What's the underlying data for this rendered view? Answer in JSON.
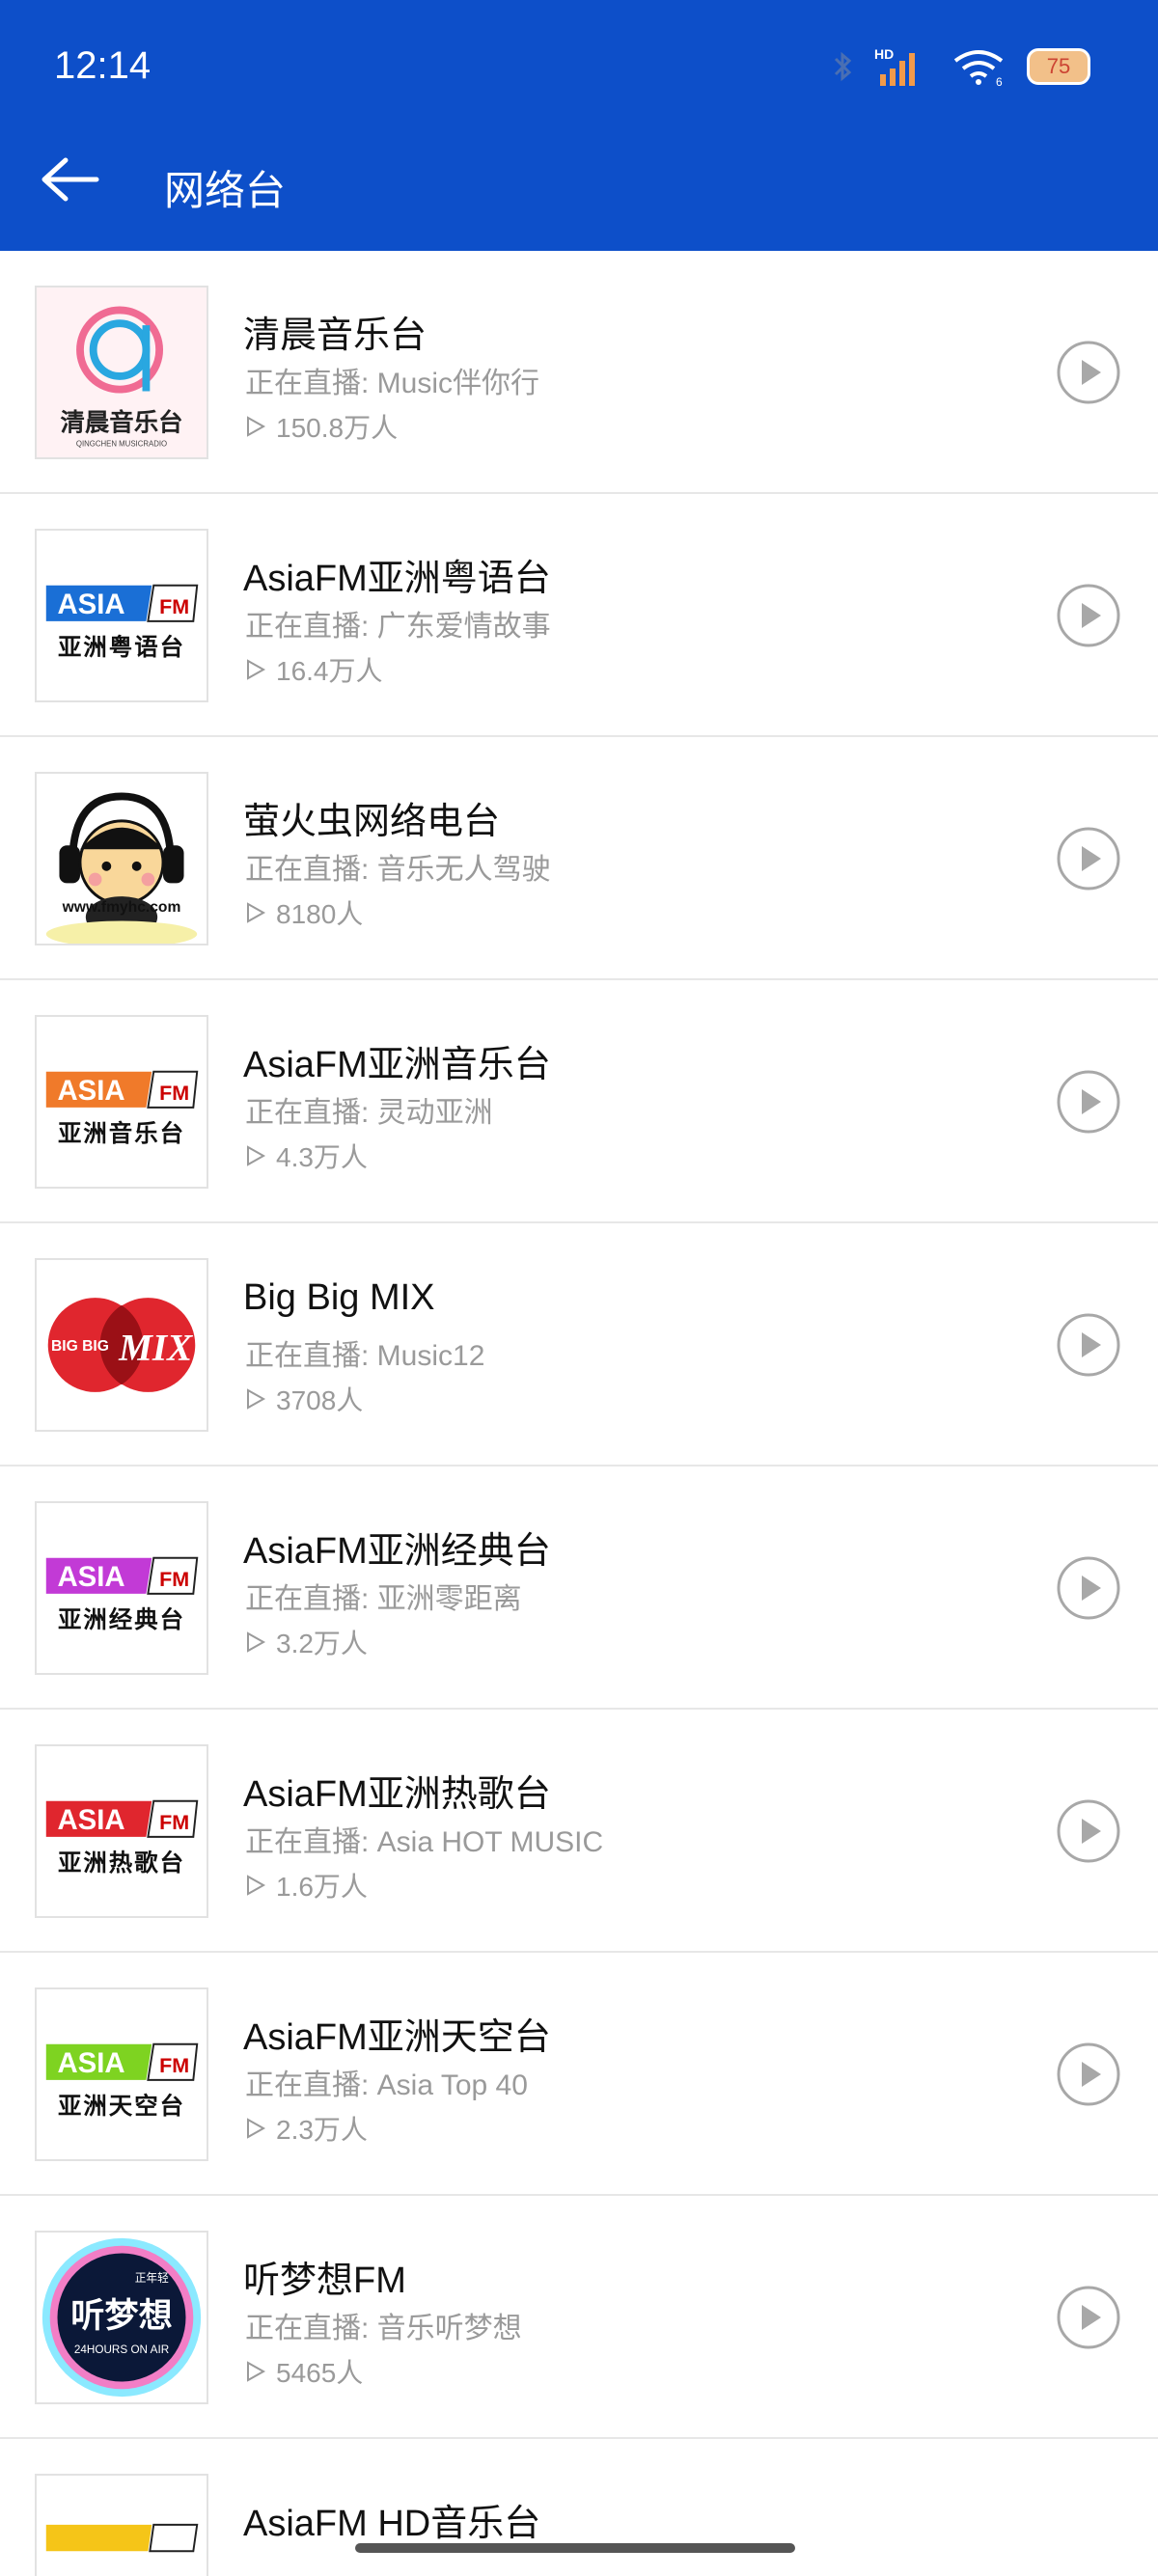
{
  "status_bar": {
    "time": "12:14",
    "network_label": "HD",
    "wifi_sub": "6",
    "battery": "75"
  },
  "header": {
    "title": "网络台"
  },
  "stations": [
    {
      "name": "清晨音乐台",
      "live": "正在直播: Music伴你行",
      "listeners": "150.8万人",
      "logo": "qingchen",
      "logo_text": "清晨音乐台",
      "logo_sub": "QINGCHEN MUSICRADIO"
    },
    {
      "name": "AsiaFM亚洲粤语台",
      "live": "正在直播: 广东爱情故事",
      "listeners": "16.4万人",
      "logo": "asia",
      "logo_text": "亚洲粤语台",
      "accent": "#1a6fd6"
    },
    {
      "name": "萤火虫网络电台",
      "live": "正在直播: 音乐无人驾驶",
      "listeners": "8180人",
      "logo": "firefly",
      "logo_text": "www.fmyhc.com"
    },
    {
      "name": "AsiaFM亚洲音乐台",
      "live": "正在直播: 灵动亚洲",
      "listeners": "4.3万人",
      "logo": "asia",
      "logo_text": "亚洲音乐台",
      "accent": "#f07a2a"
    },
    {
      "name": "Big Big MIX",
      "live": "正在直播: Music12",
      "listeners": "3708人",
      "logo": "bigmix",
      "logo_text": "BIG BIG",
      "logo_sub": "MIX"
    },
    {
      "name": "AsiaFM亚洲经典台",
      "live": "正在直播: 亚洲零距离",
      "listeners": "3.2万人",
      "logo": "asia",
      "logo_text": "亚洲经典台",
      "accent": "#c23ad6"
    },
    {
      "name": "AsiaFM亚洲热歌台",
      "live": "正在直播: Asia HOT MUSIC",
      "listeners": "1.6万人",
      "logo": "asia",
      "logo_text": "亚洲热歌台",
      "accent": "#e0262e"
    },
    {
      "name": "AsiaFM亚洲天空台",
      "live": "正在直播: Asia Top 40",
      "listeners": "2.3万人",
      "logo": "asia",
      "logo_text": "亚洲天空台",
      "accent": "#7ed321"
    },
    {
      "name": "听梦想FM",
      "live": "正在直播: 音乐听梦想",
      "listeners": "5465人",
      "logo": "dream",
      "logo_text": "听梦想",
      "logo_sub": "24HOURS ON AIR",
      "logo_tag": "正年轻"
    },
    {
      "name": "AsiaFM HD音乐台",
      "live": "",
      "listeners": "",
      "logo": "partial",
      "accent": "#f5c518"
    }
  ],
  "asia_badge": {
    "left": "ASIA",
    "right": "FM"
  }
}
